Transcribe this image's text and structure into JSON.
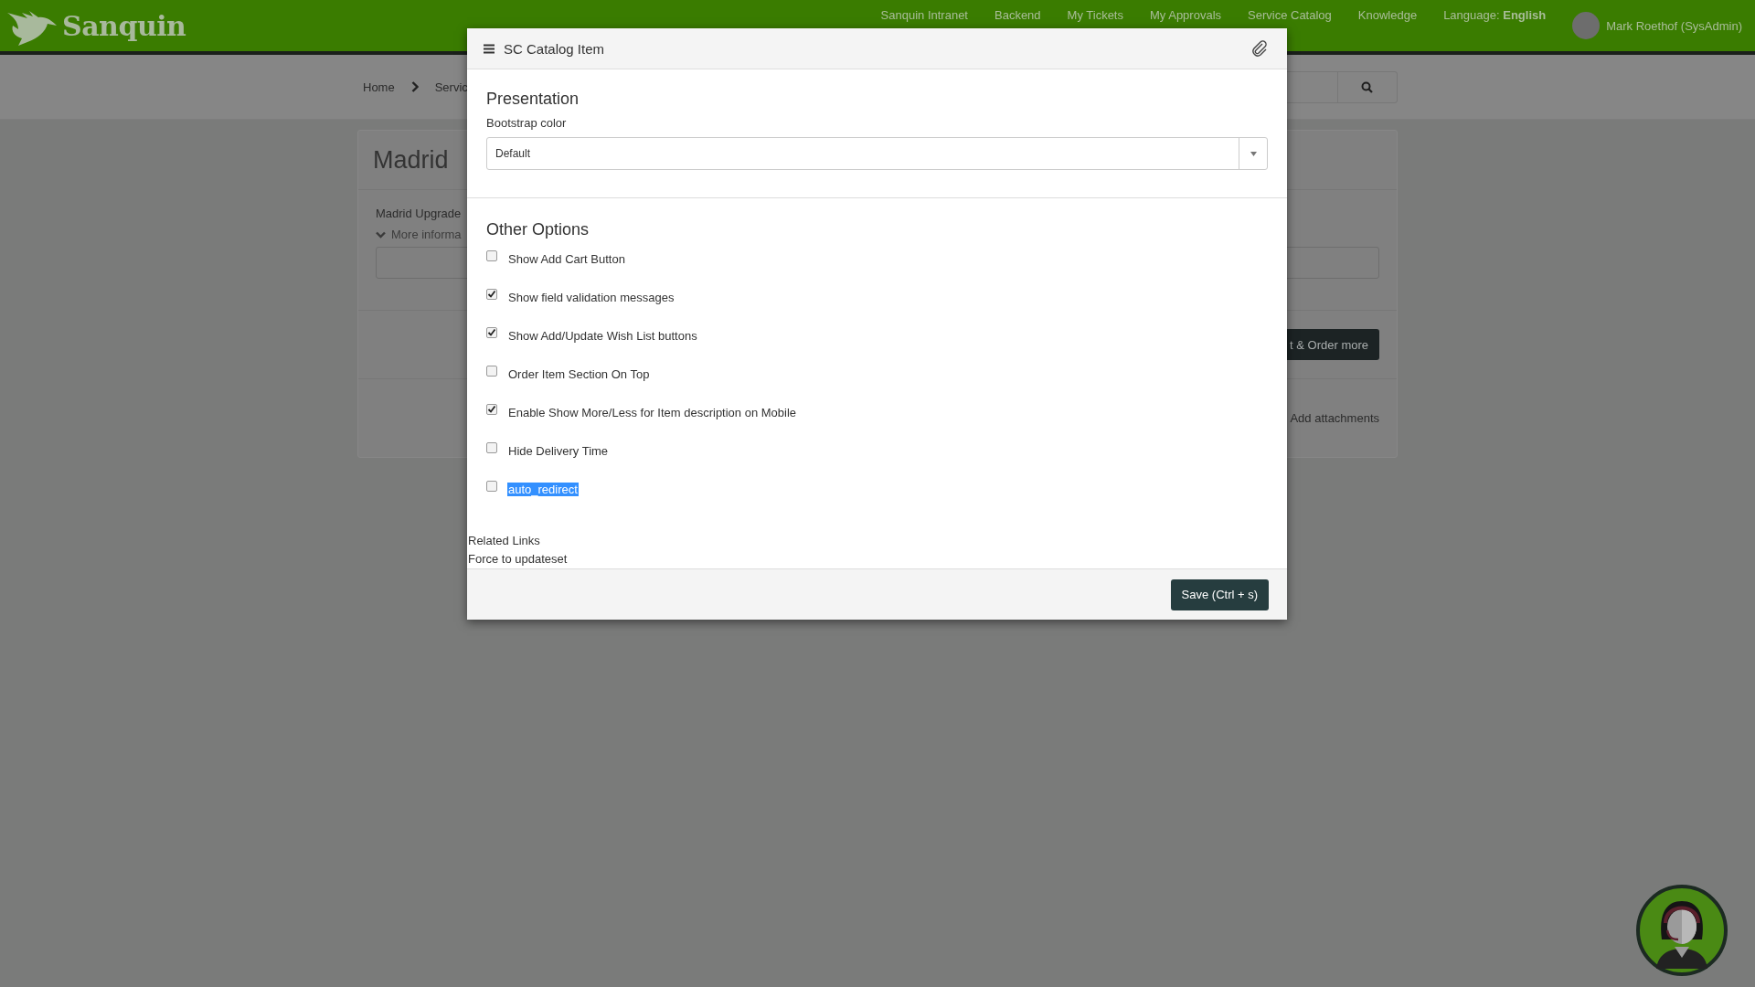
{
  "header": {
    "logo": "Sanquin",
    "nav": [
      {
        "label": "Sanquin Intranet"
      },
      {
        "label": "Backend"
      },
      {
        "label": "My Tickets"
      },
      {
        "label": "My Approvals"
      },
      {
        "label": "Service Catalog"
      },
      {
        "label": "Knowledge"
      },
      {
        "label": "Language: **English**"
      }
    ],
    "user": "Mark Roethof (SysAdmin)"
  },
  "breadcrumb": [
    "Home",
    "Servic"
  ],
  "catalog_card": {
    "title": "Madrid",
    "description": "Madrid Upgrade",
    "more_info": "More informa",
    "order_button": "t & Order more",
    "attachments": "Add attachments"
  },
  "modal": {
    "title": "SC Catalog Item",
    "presentation": {
      "heading": "Presentation",
      "label": "Bootstrap color",
      "value": "Default"
    },
    "other_options": {
      "heading": "Other Options",
      "options": [
        {
          "label": "Show Add Cart Button",
          "checked": false,
          "highlighted": false
        },
        {
          "label": "Show field validation messages",
          "checked": true,
          "highlighted": false
        },
        {
          "label": "Show Add/Update Wish List buttons",
          "checked": true,
          "highlighted": false
        },
        {
          "label": "Order Item Section On Top",
          "checked": false,
          "highlighted": false
        },
        {
          "label": "Enable Show More/Less for Item description on Mobile",
          "checked": true,
          "highlighted": false
        },
        {
          "label": "Hide Delivery Time",
          "checked": false,
          "highlighted": false
        },
        {
          "label": "auto_redirect",
          "checked": false,
          "highlighted": true
        }
      ]
    },
    "related_links": {
      "heading": "Related Links",
      "links": [
        "Force to updateset"
      ]
    },
    "save_button": "Save (Ctrl + s)"
  }
}
